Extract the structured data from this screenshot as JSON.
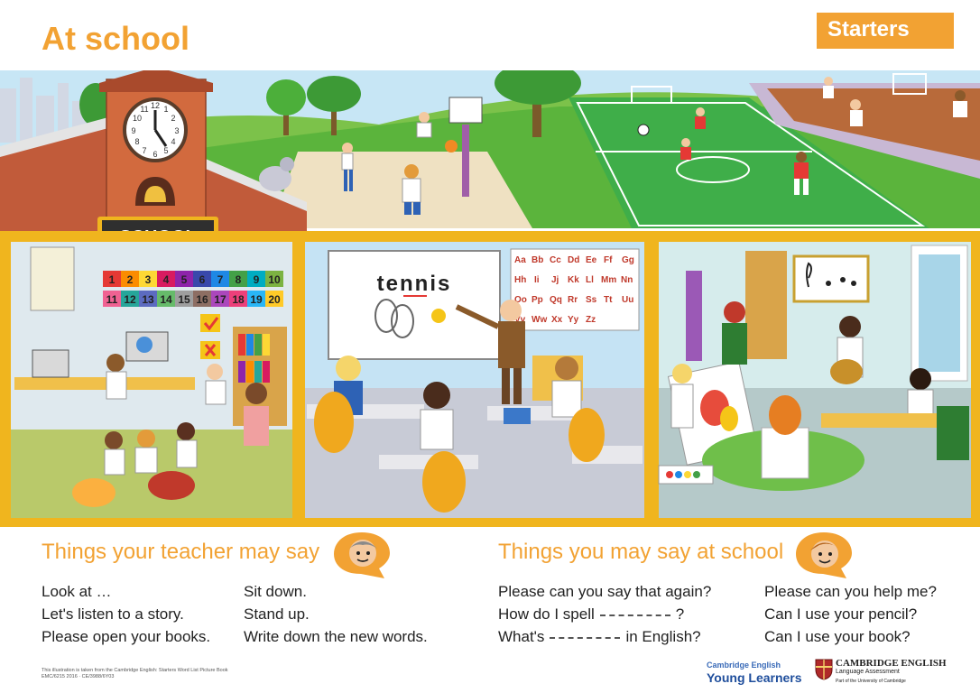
{
  "header": {
    "title": "At school",
    "level": "Starters"
  },
  "scene": {
    "clock_numerals": [
      "12",
      "1",
      "2",
      "3",
      "4",
      "5",
      "6",
      "7",
      "8",
      "9",
      "10",
      "11"
    ],
    "school_sign": "SCHOOL",
    "board_word": "tennis",
    "number_chart": [
      "1",
      "2",
      "3",
      "4",
      "5",
      "6",
      "7",
      "8",
      "9",
      "10",
      "11",
      "12",
      "13",
      "14",
      "15",
      "16",
      "17",
      "18",
      "19",
      "20"
    ],
    "number_colors": [
      "#e53935",
      "#fb8c00",
      "#fdd835",
      "#d81b60",
      "#8e24aa",
      "#3949ab",
      "#1e88e5",
      "#43a047",
      "#00acc1",
      "#7cb342",
      "#f06292",
      "#26a69a",
      "#5c6bc0",
      "#66bb6a",
      "#9e9e9e",
      "#8d6e63",
      "#ab47bc",
      "#ec407a",
      "#29b6f6",
      "#ffca28"
    ],
    "alphabet": [
      "Aa",
      "Bb",
      "Cc",
      "Dd",
      "Ee",
      "Ff",
      "Gg",
      "Hh",
      "Ii",
      "Jj",
      "Kk",
      "Ll",
      "Mm",
      "Nn",
      "Oo",
      "Pp",
      "Qq",
      "Rr",
      "Ss",
      "Tt",
      "Uu",
      "Vv",
      "Ww",
      "Xx",
      "Yy",
      "Zz"
    ]
  },
  "teacher_section": {
    "heading": "Things your teacher may say",
    "col1": [
      "Look at …",
      "Let's listen to a story.",
      "Please open your books."
    ],
    "col2": [
      "Sit down.",
      "Stand up.",
      "Write down the new words."
    ]
  },
  "student_section": {
    "heading": "Things you may say at school",
    "col1": {
      "line1": "Please can you say that again?",
      "line2_before": "How do I spell",
      "line2_after": "?",
      "line3_before": "What's",
      "line3_after": "in English?"
    },
    "col2": [
      "Please can you help me?",
      "Can I use your pencil?",
      "Can I use your book?"
    ]
  },
  "footer": {
    "credit_line1": "This illustration is taken from the Cambridge English: Starters Word List Picture Book",
    "credit_line2": "EMC/6215 2016 · CE/3988/6Y03",
    "yl_top": "Cambridge English",
    "yl_bottom": "Young Learners",
    "ce_name": "CAMBRIDGE ENGLISH",
    "ce_sub": "Language Assessment",
    "ce_tag": "Part of the University of Cambridge"
  },
  "colors": {
    "accent": "#f2a233",
    "frame": "#f0b51e",
    "pitch": "#3fae49",
    "brand_blue": "#1f4e9c"
  }
}
